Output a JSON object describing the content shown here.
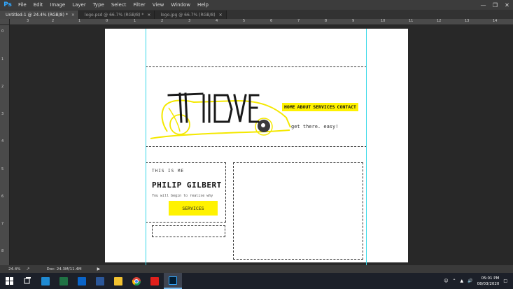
{
  "menubar": {
    "logo": "Ps",
    "items": [
      "File",
      "Edit",
      "Image",
      "Layer",
      "Type",
      "Select",
      "Filter",
      "View",
      "Window",
      "Help"
    ]
  },
  "tabs": [
    {
      "label": "Untitled-1 @ 24.4% (RGB/8) *",
      "active": true
    },
    {
      "label": "logo.psd @ 66.7% (RGB/8) *",
      "active": false
    },
    {
      "label": "logo.jpg @ 66.7% (RGB/8)",
      "active": false
    }
  ],
  "ruler_top": [
    "3",
    "2",
    "1",
    "0",
    "1",
    "2",
    "3",
    "4",
    "5",
    "6",
    "7",
    "8",
    "9",
    "10",
    "11",
    "12",
    "13",
    "14"
  ],
  "ruler_left": [
    "0",
    "1",
    "2",
    "3",
    "4",
    "5",
    "6",
    "7",
    "8"
  ],
  "mockup": {
    "logo_text": "TIDVE",
    "nav": [
      "HOME",
      "ABOUT",
      "SERVICES",
      "CONTACT"
    ],
    "tagline": "get there. easy!",
    "pre_title": "THIS IS ME",
    "name": "PHILIP GILBERT",
    "subtitle": "You will begin to realise why",
    "services_button": "SERVICES"
  },
  "statusbar": {
    "zoom": "24.4%",
    "doc": "Doc: 24.3M/11.4M",
    "arrow": "▶"
  },
  "taskbar": {
    "time": "05:01 PM",
    "date": "08/03/2020"
  },
  "colors": {
    "accent_yellow": "#fff200",
    "guide": "#35d8e8",
    "ps_blue": "#31a8ff"
  }
}
